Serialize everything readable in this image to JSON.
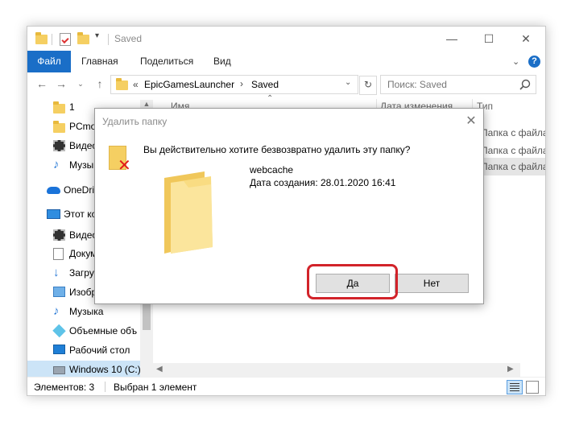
{
  "window": {
    "title": "Saved",
    "controls": {
      "minimize": "—",
      "maximize": "☐",
      "close": "✕"
    }
  },
  "ribbon": {
    "tabs": [
      "Файл",
      "Главная",
      "Поделиться",
      "Вид"
    ]
  },
  "address": {
    "prefix": "«",
    "crumbs": [
      "EpicGamesLauncher",
      "Saved"
    ],
    "separator": "›",
    "search_placeholder": "Поиск: Saved"
  },
  "sidebar": {
    "items": [
      {
        "label": "1",
        "icon": "folder-icon"
      },
      {
        "label": "PCmo",
        "icon": "folder-icon"
      },
      {
        "label": "Видео",
        "icon": "video-icon"
      },
      {
        "label": "Музыка",
        "icon": "music-icon"
      },
      {
        "label": "OneDrive",
        "icon": "cloud-icon"
      },
      {
        "label": "Этот ко",
        "icon": "computer-icon"
      },
      {
        "label": "Видео",
        "icon": "video-icon"
      },
      {
        "label": "Докум",
        "icon": "document-icon"
      },
      {
        "label": "Загру",
        "icon": "download-icon"
      },
      {
        "label": "Изобр",
        "icon": "image-icon"
      },
      {
        "label": "Музыка",
        "icon": "music-icon"
      },
      {
        "label": "Объемные объ",
        "icon": "3d-icon"
      },
      {
        "label": "Рабочий стол",
        "icon": "desktop-icon"
      },
      {
        "label": "Windows 10 (C:)",
        "icon": "drive-icon"
      }
    ]
  },
  "content": {
    "headers": {
      "name": "Имя",
      "date": "Дата изменения",
      "type": "Тип"
    },
    "rows": [
      {
        "type": "Папка с файлам"
      },
      {
        "type": "Папка с файлам"
      },
      {
        "type": "Папка с файлам"
      }
    ]
  },
  "status": {
    "count": "Элементов: 3",
    "selected": "Выбран 1 элемент"
  },
  "dialog": {
    "title": "Удалить папку",
    "close": "✕",
    "question": "Вы действительно хотите безвозвратно удалить эту папку?",
    "folder_name": "webcache",
    "created": "Дата создания: 28.01.2020 16:41",
    "yes_label": "Да",
    "no_label": "Нет"
  },
  "colors": {
    "accent": "#1a6ec7",
    "highlight": "#d2232a",
    "folder": "#f5cf62",
    "delete_x": "#e11a1a"
  }
}
